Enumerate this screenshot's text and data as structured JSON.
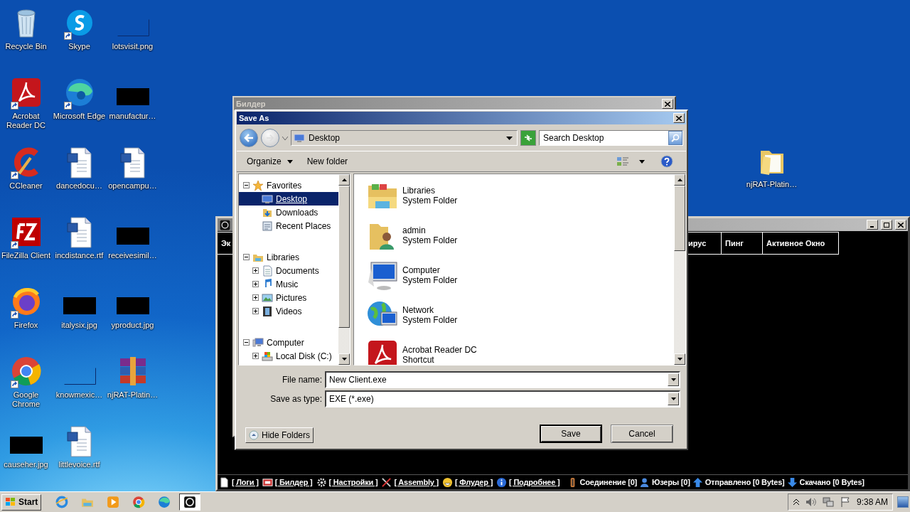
{
  "desktop_icons": [
    {
      "label": "Recycle Bin",
      "kind": "recycle",
      "shortcut": false
    },
    {
      "label": "Acrobat Reader DC",
      "kind": "acrobat",
      "shortcut": true
    },
    {
      "label": "CCleaner",
      "kind": "ccleaner",
      "shortcut": true
    },
    {
      "label": "FileZilla Client",
      "kind": "filezilla",
      "shortcut": true
    },
    {
      "label": "Firefox",
      "kind": "firefox",
      "shortcut": true
    },
    {
      "label": "Google Chrome",
      "kind": "chrome",
      "shortcut": true
    },
    {
      "label": "causeher.jpg",
      "kind": "redacted",
      "shortcut": false
    },
    {
      "label": "Skype",
      "kind": "skype",
      "shortcut": true
    },
    {
      "label": "Microsoft Edge",
      "kind": "edge",
      "shortcut": true
    },
    {
      "label": "dancedocu…",
      "kind": "word",
      "shortcut": false
    },
    {
      "label": "incdistance.rtf",
      "kind": "word",
      "shortcut": false
    },
    {
      "label": "italysix.jpg",
      "kind": "redacted",
      "shortcut": false
    },
    {
      "label": "knowmexic…",
      "kind": "blank",
      "shortcut": false
    },
    {
      "label": "littlevoice.rtf",
      "kind": "word",
      "shortcut": false
    },
    {
      "label": "lotsvisit.png",
      "kind": "blank",
      "shortcut": false
    },
    {
      "label": "manufactur…",
      "kind": "redacted",
      "shortcut": false
    },
    {
      "label": "opencampu…",
      "kind": "word",
      "shortcut": false
    },
    {
      "label": "receivesimil…",
      "kind": "redacted",
      "shortcut": false
    },
    {
      "label": "yproduct.jpg",
      "kind": "redacted",
      "shortcut": false
    },
    {
      "label": "njRAT-Platin…",
      "kind": "winrar",
      "shortcut": false
    }
  ],
  "desktop_extra_icons": [
    {
      "label": "njRAT-Platin…",
      "kind": "folder",
      "shortcut": false
    }
  ],
  "main_window": {
    "columns": [
      {
        "label": "Эк"
      },
      {
        "label": "ирус"
      },
      {
        "label": "Пинг"
      },
      {
        "label": "Активное Окно"
      }
    ],
    "status_links": [
      {
        "label": "[ Логи ]",
        "kind": "log"
      },
      {
        "label": "[ Билдер ]",
        "kind": "builder"
      },
      {
        "label": "[ Настройки ]",
        "kind": "settings"
      },
      {
        "label": "[ Assembly ]",
        "kind": "assembly"
      },
      {
        "label": "[ Флудер ]",
        "kind": "flooder"
      },
      {
        "label": "[ Подробнее ]",
        "kind": "info"
      }
    ],
    "status_counters": [
      {
        "label": "Соединение [0]",
        "kind": "connection"
      },
      {
        "label": "Юзеры [0]",
        "kind": "users"
      },
      {
        "label": "Отправлено [0 Bytes]",
        "kind": "sent"
      },
      {
        "label": "Скачано [0 Bytes]",
        "kind": "downloaded"
      }
    ]
  },
  "builder_window": {
    "title": "Билдер"
  },
  "save_dialog": {
    "title": "Save As",
    "address": "Desktop",
    "search_placeholder": "Search Desktop",
    "toolbar": [
      {
        "label": "Organize",
        "dropdown": true
      },
      {
        "label": "New folder",
        "dropdown": false
      }
    ],
    "nav_tree": [
      {
        "label": "Favorites",
        "kind": "favorites",
        "expanded": true,
        "selected": false,
        "children": [
          {
            "label": "Desktop",
            "kind": "desktop",
            "selected": true
          },
          {
            "label": "Downloads",
            "kind": "downloads",
            "selected": false
          },
          {
            "label": "Recent Places",
            "kind": "recent",
            "selected": false
          }
        ]
      },
      {
        "label": "Libraries",
        "kind": "libraries",
        "expanded": true,
        "selected": false,
        "children": [
          {
            "label": "Documents",
            "kind": "documents",
            "expanded": false,
            "selected": false
          },
          {
            "label": "Music",
            "kind": "music",
            "expanded": false,
            "selected": false
          },
          {
            "label": "Pictures",
            "kind": "pictures",
            "expanded": false,
            "selected": false
          },
          {
            "label": "Videos",
            "kind": "videos",
            "expanded": false,
            "selected": false
          }
        ]
      },
      {
        "label": "Computer",
        "kind": "computer",
        "expanded": true,
        "selected": false,
        "children": [
          {
            "label": "Local Disk (C:)",
            "kind": "disk",
            "expanded": false,
            "selected": false
          }
        ]
      }
    ],
    "items": [
      {
        "name": "Libraries",
        "detail": "System Folder",
        "kind": "libraries"
      },
      {
        "name": "admin",
        "detail": "System Folder",
        "kind": "user"
      },
      {
        "name": "Computer",
        "detail": "System Folder",
        "kind": "computer"
      },
      {
        "name": "Network",
        "detail": "System Folder",
        "kind": "network"
      },
      {
        "name": "Acrobat Reader DC",
        "detail": "Shortcut",
        "kind": "acrobat"
      }
    ],
    "file_name_label": "File name:",
    "file_name": "New Client.exe",
    "type_label": "Save as type:",
    "save_as_type": "EXE (*.exe)",
    "hide_folders": "Hide Folders",
    "buttons": [
      {
        "label": "Save",
        "default": true
      },
      {
        "label": "Cancel",
        "default": false
      }
    ]
  },
  "taskbar": {
    "start": "Start",
    "apps": [
      {
        "kind": "ie",
        "active": false
      },
      {
        "kind": "explorer",
        "active": false
      },
      {
        "kind": "media",
        "active": false
      },
      {
        "kind": "chrome",
        "active": false
      },
      {
        "kind": "edge",
        "active": false
      },
      {
        "kind": "njrat",
        "active": true
      }
    ],
    "time": "9:38 AM"
  }
}
